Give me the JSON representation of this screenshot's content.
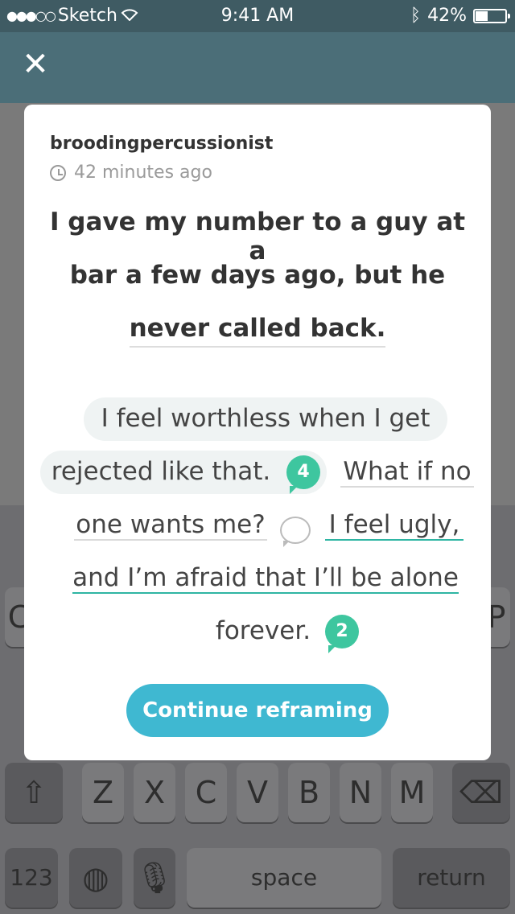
{
  "status": {
    "carrier": "Sketch",
    "time": "9:41 AM",
    "battery": "42%"
  },
  "card": {
    "username": "broodingpercussionist",
    "timestamp": "42 minutes ago",
    "headline_lines": [
      "I gave my number to a guy at a",
      "bar a few days ago, but he",
      "never called back."
    ],
    "sentences": {
      "s1_line1": "I feel worthless when I get",
      "s1_line2": "rejected like that.",
      "s1_count": "4",
      "s2_line1": "What if no",
      "s2_line2": "one wants me?",
      "s3_line1": "I feel ugly,",
      "s3_line2": "and I’m afraid that I’ll be alone",
      "s3_line3": "forever.",
      "s3_count": "2"
    },
    "continue_label": "Continue reframing"
  },
  "keyboard": {
    "row3": [
      "Z",
      "X",
      "C",
      "V",
      "B",
      "N",
      "M"
    ],
    "numbers_label": "123",
    "space_label": "space",
    "return_label": "return",
    "partial_left": "C",
    "partial_right": "P"
  },
  "colors": {
    "accent": "#3fb8d1",
    "badge": "#3ec69f",
    "nav": "#4b6e78"
  }
}
